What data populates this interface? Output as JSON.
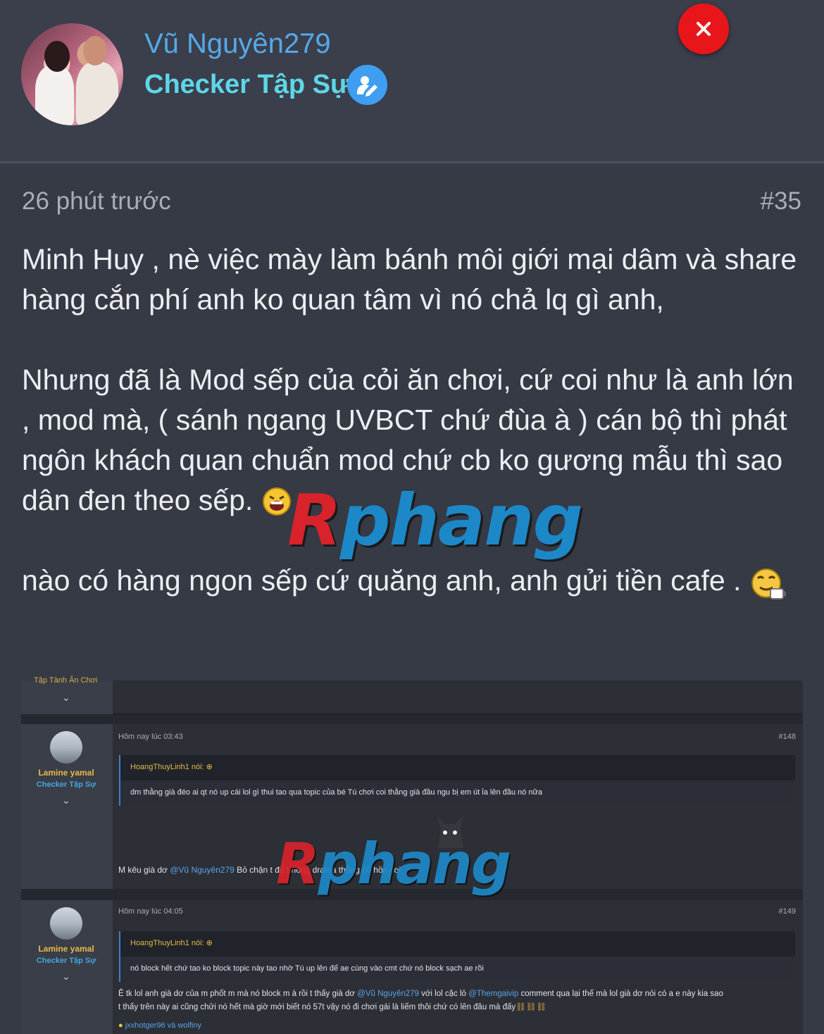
{
  "header": {
    "username": "Vũ Nguyên279",
    "role": "Checker Tập Sự"
  },
  "post": {
    "time": "26 phút trước",
    "number": "#35",
    "paragraphs": [
      "Minh Huy , nè việc mày làm bánh môi giới mại dâm và share hàng cắn phí anh ko quan tâm vì nó chả lq gì anh,",
      "Nhưng đã là Mod sếp của cỏi ăn chơi, cứ coi như là anh lớn , mod mà, ( sánh ngang UVBCT chứ đùa à ) cán bộ thì phát ngôn khách quan chuẩn mod chứ cb ko gương mẫu thì sao dân đen theo sếp.",
      "nào có hàng ngon sếp cứ quăng anh, anh gửi tiền cafe ."
    ],
    "watermark": {
      "red": "R",
      "blue": "phang",
      "full": "Rphang"
    }
  },
  "screenshot": {
    "cut_text": "Tập Tành Ăn Chơi",
    "messages": [
      {
        "author": "Lamine yamal",
        "role": "Checker Tập Sự",
        "time": "Hôm nay lúc 03:43",
        "number": "#148",
        "quote_author": "HoangThuyLinh1 nói:",
        "quote_text": "dm thằng già đéo ai qt nó up cái lol gì thui tao qua topic của bé Tú chơi coi thằng già đầu ngu bị em út ỉa lên đầu nó nữa",
        "text_before": "M kêu già dơ ",
        "mention": "@Vũ Nguyên279",
        "text_after": " Bỏ chặn t để t hóng drama thằng cô hồn coi"
      },
      {
        "author": "Lamine yamal",
        "role": "Checker Tập Sự",
        "time": "Hôm nay lúc 04:05",
        "number": "#149",
        "quote_author": "HoangThuyLinh1 nói:",
        "quote_text": "nó block hết chứ tao ko block topic này tao nhờ Tú up lên để ae cùng vào cmt chứ nó block sạch ae rồi",
        "line1_a": "Ê tk lol anh già dơ của m phốt m mà nó block m à rồi t thấy già dơ ",
        "line1_mention1": "@Vũ Nguyên279",
        "line1_b": " với lol cặc lỏ ",
        "line1_mention2": "@Themgaivip",
        "line1_c": " comment qua lại thế mà lol già dơ nói có a e này kia sao",
        "line2": "t thấy trên này ai cũng chửi nó hết mà giờ mới biết nó 57t vậy nó đi chơi gái là liếm thôi chứ có lên đâu mà đấy",
        "reactions": "jxxhotger96 và wolfiny"
      }
    ]
  },
  "icons": {
    "close": "close-icon",
    "role": "user-edit-icon",
    "chevron": "chevron-down-icon",
    "reply": "arrow-up-circle-icon"
  },
  "colors": {
    "background": "#363a45",
    "username": "#56a9e8",
    "role": "#5ed6e8",
    "close": "#e8161b",
    "text": "#eceef1"
  }
}
